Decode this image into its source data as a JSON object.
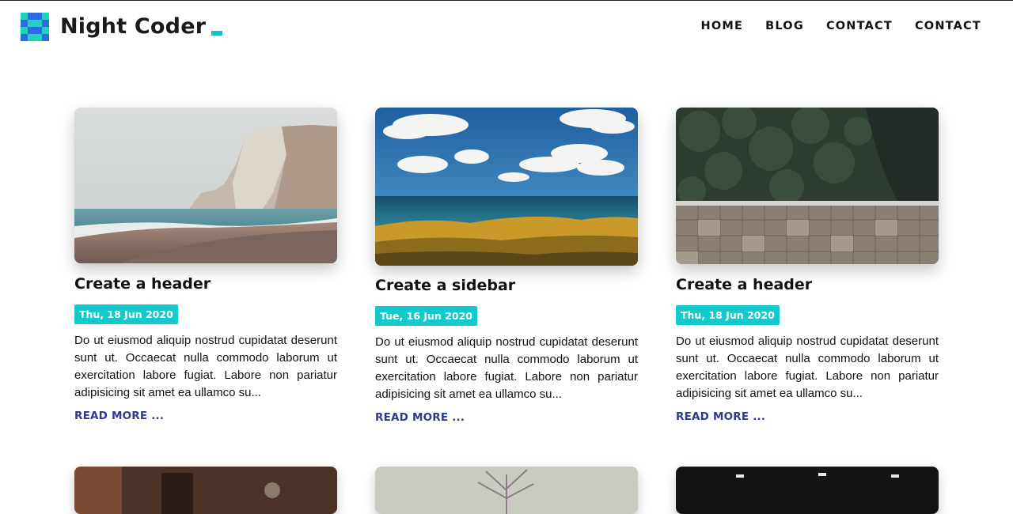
{
  "site": {
    "name": "Night Coder",
    "brand_color": "#13c9cc",
    "link_color": "#2e3a8c"
  },
  "nav": {
    "items": [
      "HOME",
      "BLOG",
      "CONTACT",
      "CONTACT"
    ]
  },
  "posts": [
    {
      "title": "Create a header",
      "date": "Thu, 18 Jun 2020",
      "excerpt": "Do ut eiusmod aliquip nostrud cupidatat deserunt sunt ut. Occaecat nulla commodo laborum ut exercitation labore fugiat. Labore non pariatur adipisicing sit amet ea ullamco su...",
      "read_more": "READ MORE ...",
      "image": "foggy-cliff-beach"
    },
    {
      "title": "Create a sidebar",
      "date": "Tue, 16 Jun 2020",
      "excerpt": "Do ut eiusmod aliquip nostrud cupidatat deserunt sunt ut. Occaecat nulla commodo laborum ut exercitation labore fugiat. Labore non pariatur adipisicing sit amet ea ullamco su...",
      "read_more": "READ MORE ...",
      "image": "sea-grass-clouds"
    },
    {
      "title": "Create a header",
      "date": "Thu, 18 Jun 2020",
      "excerpt": "Do ut eiusmod aliquip nostrud cupidatat deserunt sunt ut. Occaecat nulla commodo laborum ut exercitation labore fugiat. Labore non pariatur adipisicing sit amet ea ullamco su...",
      "read_more": "READ MORE ...",
      "image": "aerial-boardwalk-forest"
    }
  ]
}
